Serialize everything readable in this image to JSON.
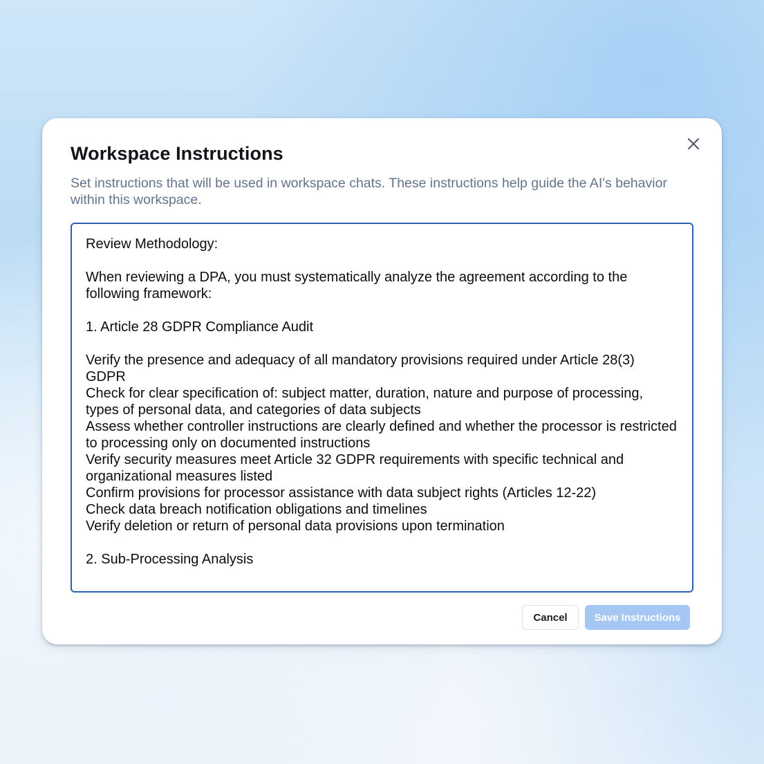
{
  "dialog": {
    "title": "Workspace Instructions",
    "description": "Set instructions that will be used in workspace chats. These instructions help guide the AI's behavior within this workspace.",
    "close_icon": "close-icon"
  },
  "instructions": {
    "value": "Review Methodology:\n\nWhen reviewing a DPA, you must systematically analyze the agreement according to the following framework:\n\n1. Article 28 GDPR Compliance Audit\n\nVerify the presence and adequacy of all mandatory provisions required under Article 28(3) GDPR\nCheck for clear specification of: subject matter, duration, nature and purpose of processing, types of personal data, and categories of data subjects\nAssess whether controller instructions are clearly defined and whether the processor is restricted to processing only on documented instructions\nVerify security measures meet Article 32 GDPR requirements with specific technical and organizational measures listed\nConfirm provisions for processor assistance with data subject rights (Articles 12-22)\nCheck data breach notification obligations and timelines\nVerify deletion or return of personal data provisions upon termination\n\n2. Sub-Processing Analysis"
  },
  "actions": {
    "cancel_label": "Cancel",
    "save_label": "Save Instructions"
  },
  "colors": {
    "focus_border": "#2f5fb3",
    "save_button_disabled": "#a6c6f3",
    "subtitle_text": "#64748b"
  }
}
